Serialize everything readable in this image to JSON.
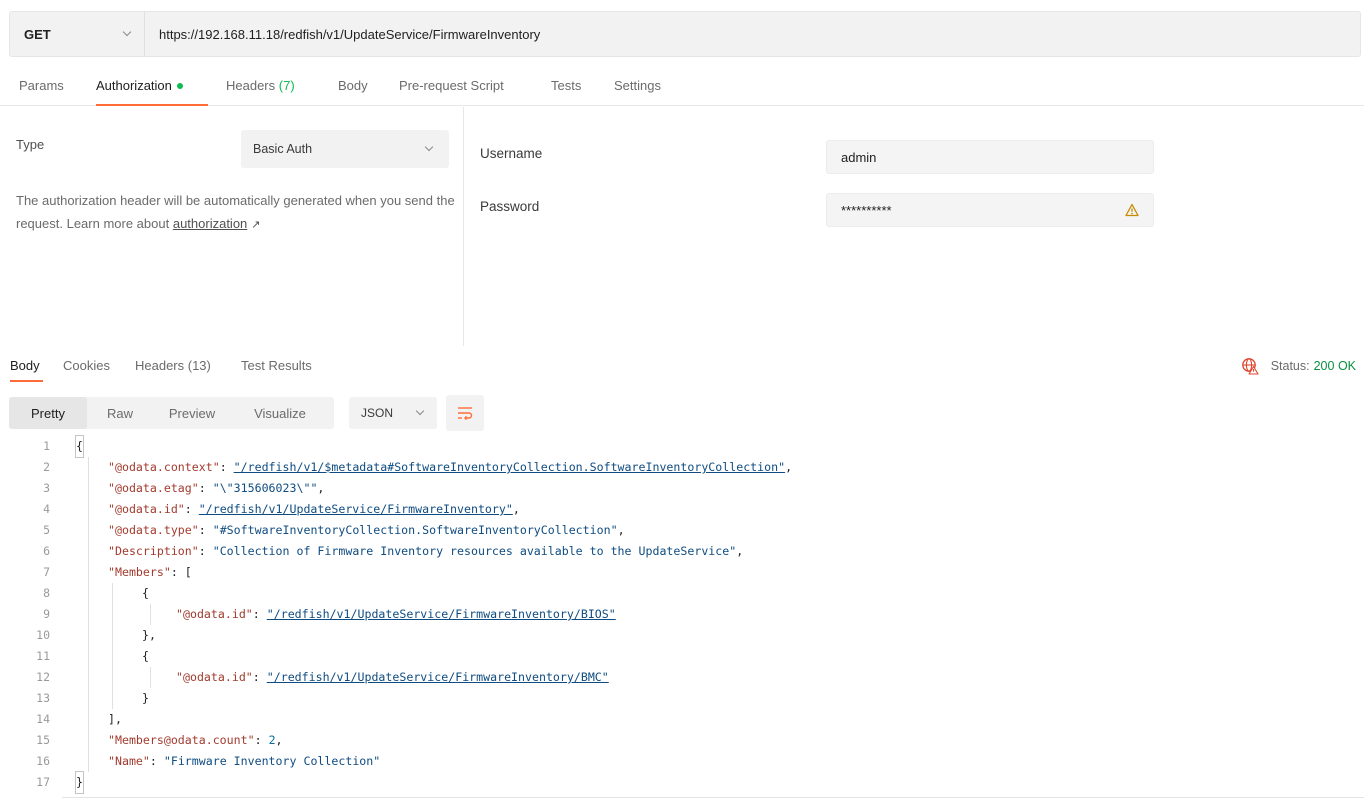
{
  "request": {
    "method": "GET",
    "url": "https://192.168.11.18/redfish/v1/UpdateService/FirmwareInventory"
  },
  "request_tabs": {
    "params": "Params",
    "authorization": "Authorization",
    "headers": "Headers",
    "headers_count": "(7)",
    "body": "Body",
    "pre_request": "Pre-request Script",
    "tests": "Tests",
    "settings": "Settings"
  },
  "auth": {
    "type_label": "Type",
    "type_value": "Basic Auth",
    "help_text": "The authorization header will be automatically generated when you send the request. Learn more about",
    "help_link": "authorization",
    "help_arrow": "↗",
    "username_label": "Username",
    "username_value": "admin",
    "password_label": "Password",
    "password_value": "**********"
  },
  "response_tabs": {
    "body": "Body",
    "cookies": "Cookies",
    "headers": "Headers (13)",
    "test_results": "Test Results",
    "status_label": "Status:",
    "status_value": "200 OK"
  },
  "view_bar": {
    "pretty": "Pretty",
    "raw": "Raw",
    "preview": "Preview",
    "visualize": "Visualize",
    "format": "JSON"
  },
  "colors": {
    "accent": "#ff6c37",
    "success": "#0cbb52",
    "status_ok": "#0a8f3f",
    "json_key": "#a33b2e",
    "json_string": "#0f4c81"
  },
  "code": {
    "line_numbers": [
      "1",
      "2",
      "3",
      "4",
      "5",
      "6",
      "7",
      "8",
      "9",
      "10",
      "11",
      "12",
      "13",
      "14",
      "15",
      "16",
      "17"
    ],
    "open_brace": "{",
    "close_brace": "}",
    "k_context": "\"@odata.context\"",
    "v_context": "\"/redfish/v1/$metadata#SoftwareInventoryCollection.SoftwareInventoryCollection\"",
    "k_etag": "\"@odata.etag\"",
    "v_etag": "\"\\\"315606023\\\"\"",
    "k_id": "\"@odata.id\"",
    "v_id": "\"/redfish/v1/UpdateService/FirmwareInventory\"",
    "k_type": "\"@odata.type\"",
    "v_type": "\"#SoftwareInventoryCollection.SoftwareInventoryCollection\"",
    "k_description": "\"Description\"",
    "v_description": "\"Collection of Firmware Inventory resources available to the UpdateService\"",
    "k_members": "\"Members\"",
    "members_open": "[",
    "member_open": "{",
    "member_close": "}",
    "member_close_comma": "},",
    "k_member_id": "\"@odata.id\"",
    "v_member_bios": "\"/redfish/v1/UpdateService/FirmwareInventory/BIOS\"",
    "v_member_bmc": "\"/redfish/v1/UpdateService/FirmwareInventory/BMC\"",
    "members_close": "],",
    "k_count": "\"Members@odata.count\"",
    "v_count": "2",
    "k_name": "\"Name\"",
    "v_name": "\"Firmware Inventory Collection\""
  }
}
